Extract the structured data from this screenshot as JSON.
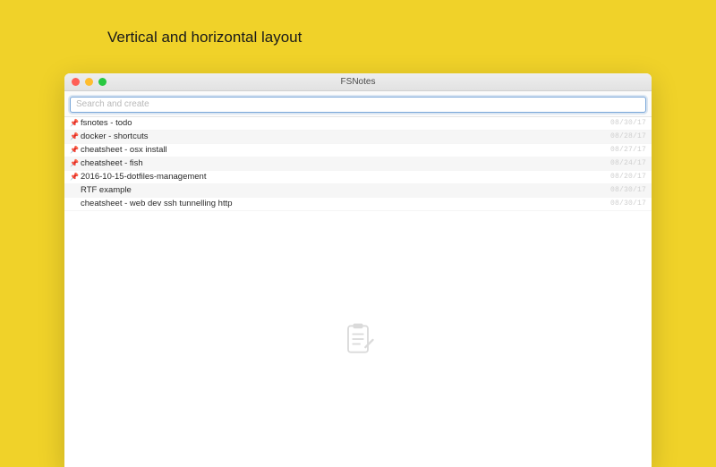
{
  "heading": "Vertical and horizontal layout",
  "window": {
    "title": "FSNotes",
    "search": {
      "placeholder": "Search and create",
      "value": ""
    }
  },
  "notes": [
    {
      "pinned": true,
      "title": "fsnotes - todo",
      "date": "08/30/17"
    },
    {
      "pinned": true,
      "title": "docker - shortcuts",
      "date": "08/28/17"
    },
    {
      "pinned": true,
      "title": "cheatsheet - osx install",
      "date": "08/27/17"
    },
    {
      "pinned": true,
      "title": "cheatsheet - fish",
      "date": "08/24/17"
    },
    {
      "pinned": true,
      "title": "2016-10-15-dotfiles-management",
      "date": "08/20/17"
    },
    {
      "pinned": false,
      "title": "RTF example",
      "date": "08/30/17"
    },
    {
      "pinned": false,
      "title": "cheatsheet - web dev ssh tunnelling http",
      "date": "08/30/17"
    }
  ],
  "icons": {
    "pin": "📌"
  }
}
